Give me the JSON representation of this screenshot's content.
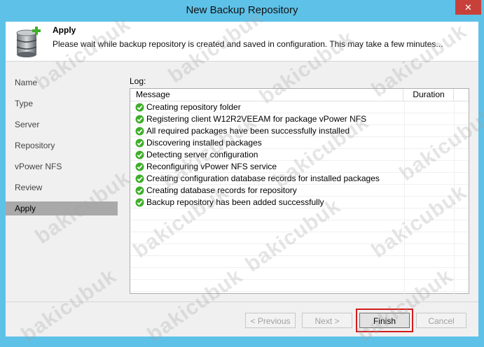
{
  "window": {
    "title": "New Backup Repository",
    "close_label": "✕"
  },
  "header": {
    "title": "Apply",
    "description": "Please wait while backup repository is created and saved in configuration. This may take a few minutes..."
  },
  "steps": [
    {
      "label": "Name",
      "active": false
    },
    {
      "label": "Type",
      "active": false
    },
    {
      "label": "Server",
      "active": false
    },
    {
      "label": "Repository",
      "active": false
    },
    {
      "label": "vPower NFS",
      "active": false
    },
    {
      "label": "Review",
      "active": false
    },
    {
      "label": "Apply",
      "active": true
    }
  ],
  "log": {
    "label": "Log:",
    "columns": {
      "message": "Message",
      "duration": "Duration"
    },
    "rows": [
      {
        "message": "Creating repository folder",
        "duration": ""
      },
      {
        "message": "Registering client W12R2VEEAM for package vPower NFS",
        "duration": ""
      },
      {
        "message": "All required packages have been successfully installed",
        "duration": ""
      },
      {
        "message": "Discovering installed packages",
        "duration": ""
      },
      {
        "message": "Detecting server configuration",
        "duration": ""
      },
      {
        "message": "Reconfiguring vPower NFS service",
        "duration": ""
      },
      {
        "message": "Creating configuration database records for installed packages",
        "duration": ""
      },
      {
        "message": "Creating database records for repository",
        "duration": ""
      },
      {
        "message": "Backup repository has been added successfully",
        "duration": ""
      }
    ],
    "empty_rows": 8
  },
  "buttons": {
    "previous": "< Previous",
    "next": "Next >",
    "finish": "Finish",
    "cancel": "Cancel"
  },
  "watermark": "bakicubuk",
  "colors": {
    "title_bar": "#5ec1e8",
    "close_button": "#c7413a",
    "success_check": "#3fae2a",
    "highlight": "#d41c1c",
    "active_step": "#a9a9a9"
  }
}
